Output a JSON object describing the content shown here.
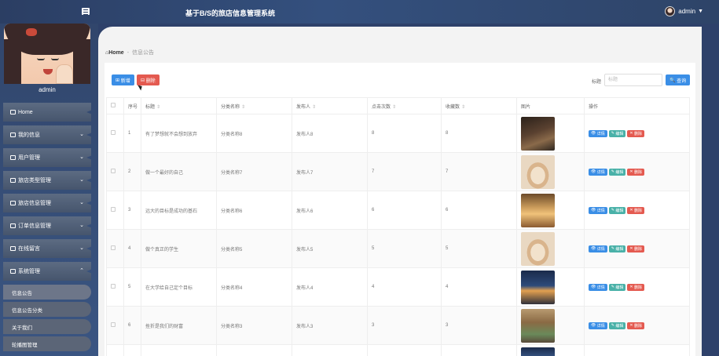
{
  "header": {
    "title": "基于B/S的旅店信息管理系统",
    "user": "admin"
  },
  "sidebar": {
    "profile_name": "admin",
    "items": [
      {
        "label": "Home",
        "icon": "home-icon",
        "has_arrow": false
      },
      {
        "label": "我的信息",
        "icon": "profile-icon",
        "has_arrow": true
      },
      {
        "label": "用户管理",
        "icon": "users-icon",
        "has_arrow": true
      },
      {
        "label": "旅店类型管理",
        "icon": "comment-icon",
        "has_arrow": true
      },
      {
        "label": "旅店信息管理",
        "icon": "hotel-icon",
        "has_arrow": true
      },
      {
        "label": "订单信息管理",
        "icon": "flag-icon",
        "has_arrow": true
      },
      {
        "label": "在线留言",
        "icon": "message-icon",
        "has_arrow": true
      },
      {
        "label": "系统管理",
        "icon": "system-icon",
        "has_arrow": true
      }
    ],
    "submenu": [
      "信息公告",
      "信息公告分类",
      "关于我们",
      "轮播图管理"
    ]
  },
  "breadcrumb": {
    "home": "Home",
    "current": "信息公告"
  },
  "toolbar": {
    "add_label": "新增",
    "delete_label": "删除",
    "search_label": "标题",
    "search_placeholder": "标题",
    "search_button": "查询"
  },
  "table": {
    "headers": [
      "序号",
      "标题",
      "分类名称",
      "发布人",
      "点击次数",
      "收藏数",
      "图片",
      "操作"
    ],
    "action_labels": {
      "view": "详情",
      "edit": "编辑",
      "delete": "删除"
    },
    "rows": [
      {
        "no": "1",
        "title": "有了梦想就不会想到放弃",
        "category": "分类名称8",
        "publisher": "发布人8",
        "clicks": "8",
        "favorites": "8",
        "image": "dark-wood-interior"
      },
      {
        "no": "2",
        "title": "做一个最好的自己",
        "category": "分类名称7",
        "publisher": "发布人7",
        "clicks": "7",
        "favorites": "7",
        "image": "arched-room"
      },
      {
        "no": "3",
        "title": "远大的目标是成功的基石",
        "category": "分类名称6",
        "publisher": "发布人6",
        "clicks": "6",
        "favorites": "6",
        "image": "warm-lobby"
      },
      {
        "no": "4",
        "title": "做个真正的学生",
        "category": "分类名称5",
        "publisher": "发布人5",
        "clicks": "5",
        "favorites": "5",
        "image": "arched-room"
      },
      {
        "no": "5",
        "title": "在大学给自己定个目标",
        "category": "分类名称4",
        "publisher": "发布人4",
        "clicks": "4",
        "favorites": "4",
        "image": "night-exterior"
      },
      {
        "no": "6",
        "title": "挫折是我们的财富",
        "category": "分类名称3",
        "publisher": "发布人3",
        "clicks": "3",
        "favorites": "3",
        "image": "wooden-pavilion"
      }
    ]
  },
  "colors": {
    "header": "#2b3e63",
    "primary": "#3a8ee6",
    "danger": "#e45a50",
    "success": "#49b1a8"
  }
}
